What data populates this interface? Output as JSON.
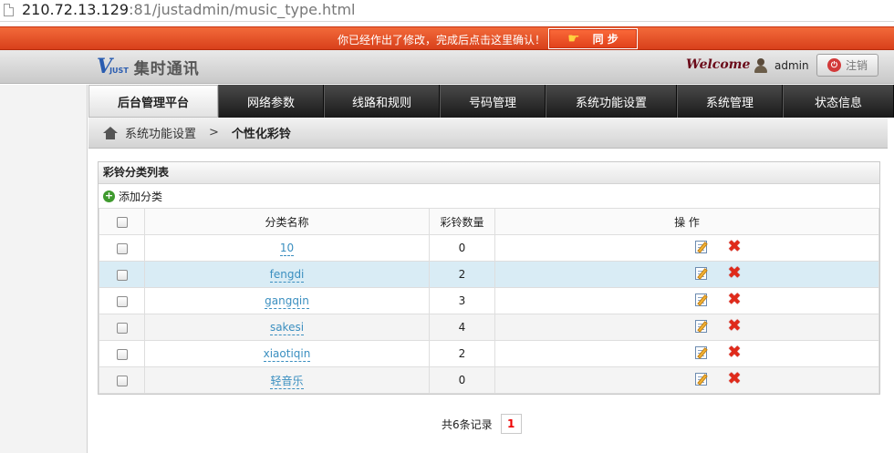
{
  "browser": {
    "url_host": "210.72.13.129",
    "url_rest": ":81/justadmin/music_type.html"
  },
  "alert": {
    "message": "你已经作出了修改，完成后点击这里确认！",
    "sync_label": "同 步"
  },
  "header": {
    "logo_v": "V",
    "logo_just": "JUST",
    "logo_cn": "集时通讯",
    "welcome": "Welcome",
    "username": "admin",
    "logout_label": "注销"
  },
  "nav": {
    "items": [
      {
        "label": "后台管理平台",
        "active": true
      },
      {
        "label": "网络参数",
        "active": false
      },
      {
        "label": "线路和规则",
        "active": false
      },
      {
        "label": "号码管理",
        "active": false
      },
      {
        "label": "系统功能设置",
        "active": false
      },
      {
        "label": "系统管理",
        "active": false
      },
      {
        "label": "状态信息",
        "active": false
      }
    ]
  },
  "breadcrumb": {
    "parent": "系统功能设置",
    "separator": ">",
    "current": "个性化彩铃"
  },
  "panel": {
    "title": "彩铃分类列表",
    "add_label": "添加分类",
    "columns": {
      "name": "分类名称",
      "count": "彩铃数量",
      "ops": "操  作"
    },
    "rows": [
      {
        "name": "10",
        "count": "0"
      },
      {
        "name": "fengdi",
        "count": "2"
      },
      {
        "name": "gangqin",
        "count": "3"
      },
      {
        "name": "sakesi",
        "count": "4"
      },
      {
        "name": "xiaotiqin",
        "count": "2"
      },
      {
        "name": "轻音乐",
        "count": "0"
      }
    ]
  },
  "pager": {
    "total_text": "共6条记录",
    "current_page": "1"
  },
  "colors": {
    "alert_red": "#e0461f",
    "link_blue": "#3b8fc0",
    "highlight_row": "#d9ecf5",
    "nav_dark": "#1e1e1e"
  }
}
